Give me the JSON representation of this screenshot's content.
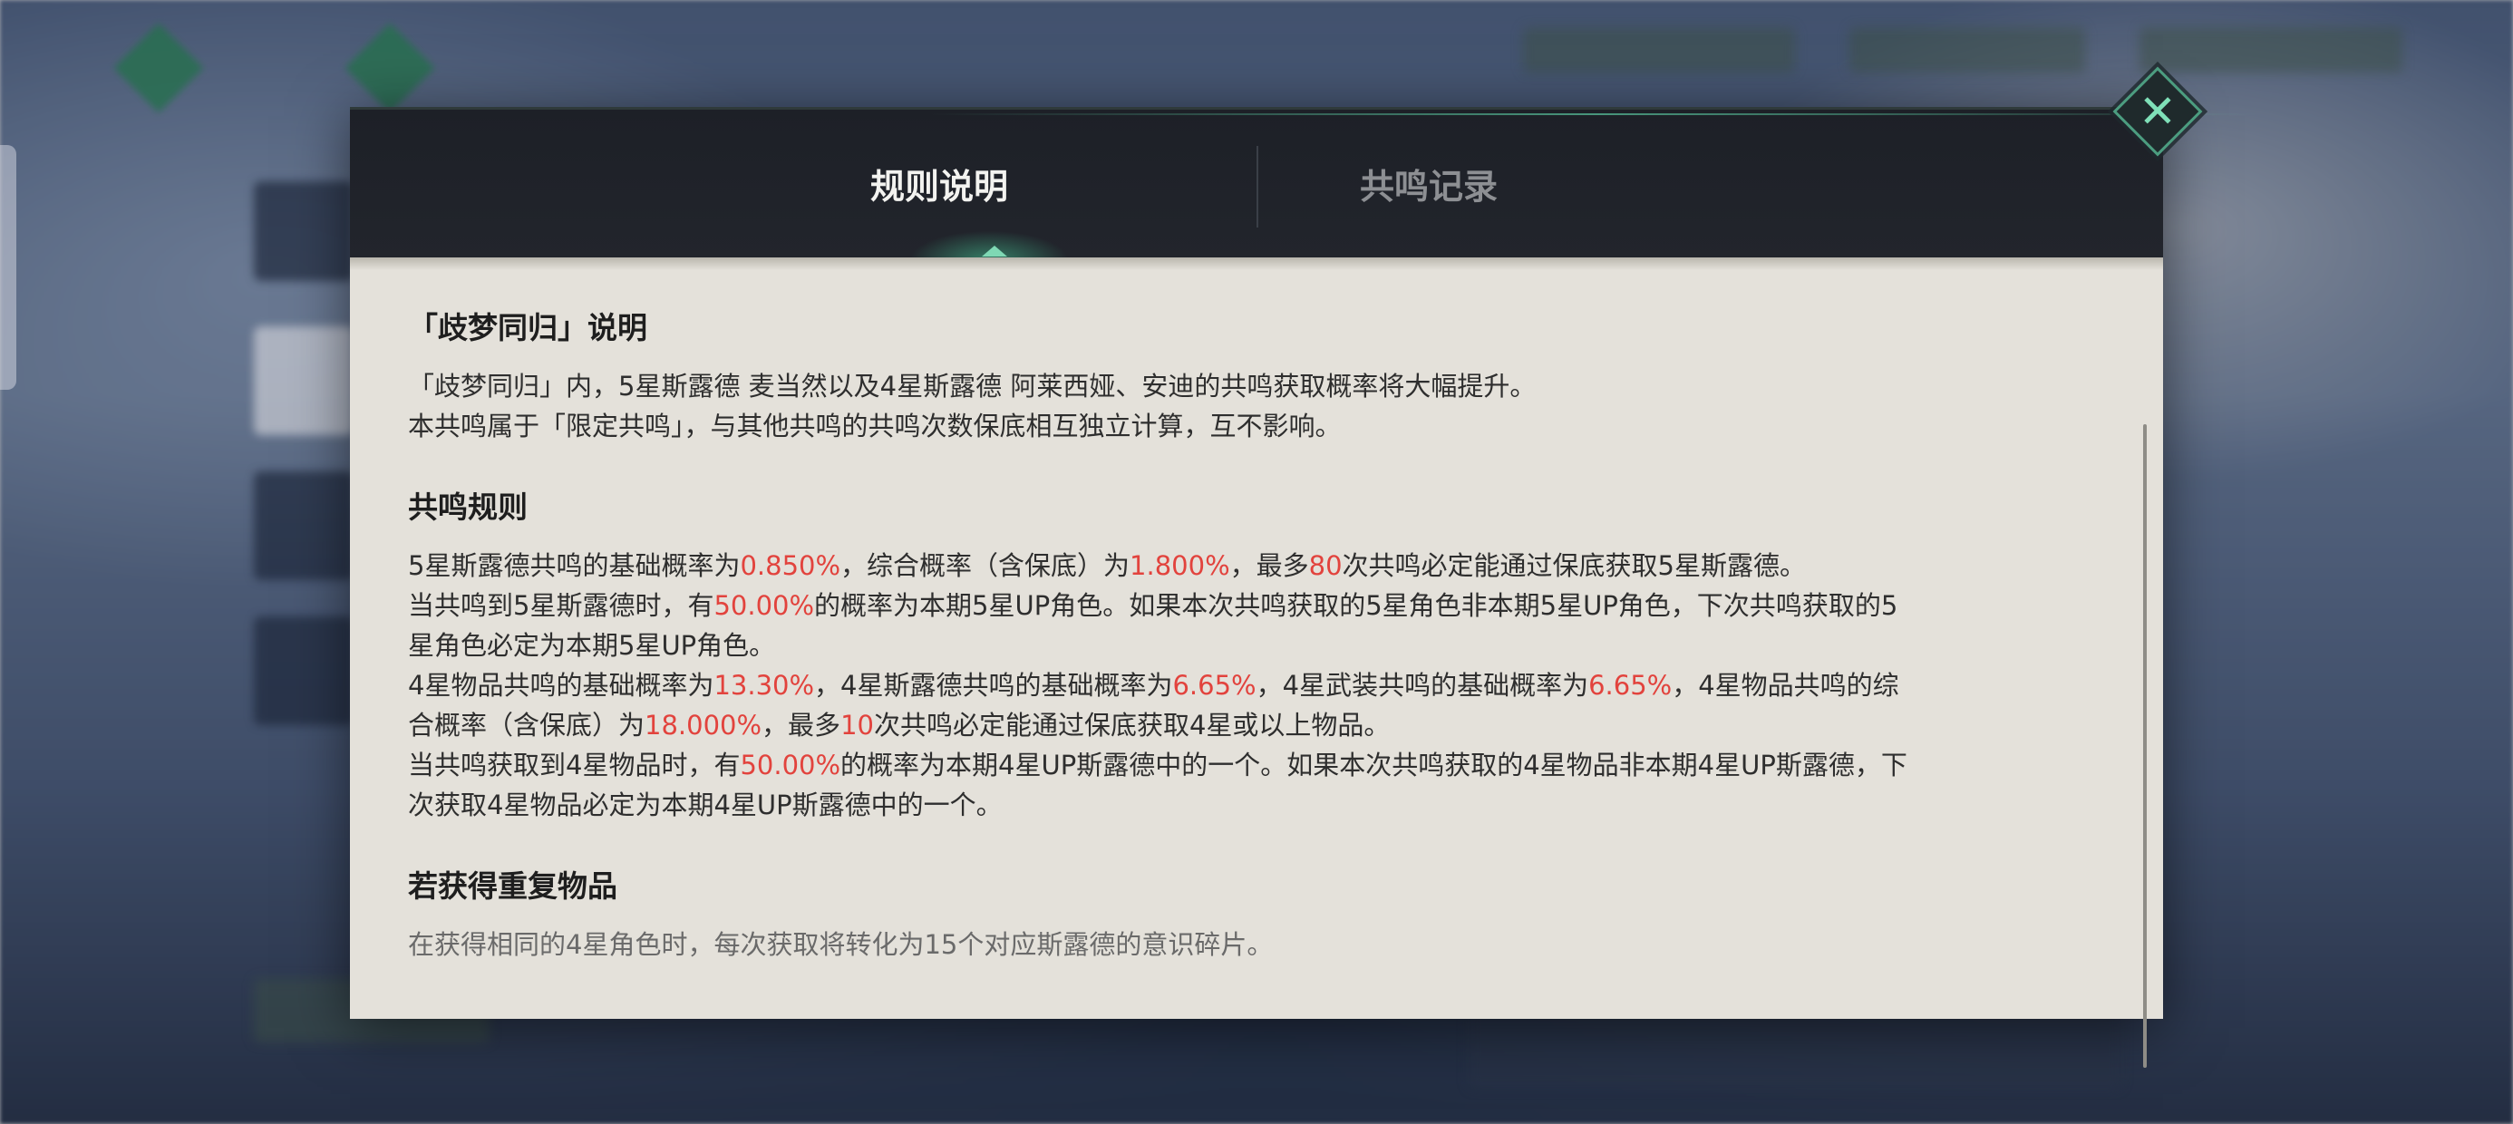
{
  "tabs": {
    "rules": "规则说明",
    "records": "共鸣记录"
  },
  "close_icon": "close-x-icon",
  "section1": {
    "title": "「歧梦同归」说明",
    "lines": [
      "「歧梦同归」内，5星斯露德 麦当然以及4星斯露德 阿莱西娅、安迪的共鸣获取概率将大幅提升。",
      "本共鸣属于「限定共鸣」，与其他共鸣的共鸣次数保底相互独立计算，互不影响。"
    ]
  },
  "section2": {
    "title": "共鸣规则",
    "p1": {
      "a": "5星斯露德共鸣的基础概率为",
      "v1": "0.850%",
      "b": "，综合概率（含保底）为",
      "v2": "1.800%",
      "c": "，最多",
      "v3": "80",
      "d": "次共鸣必定能通过保底获取5星斯露德。"
    },
    "p2": {
      "a": "当共鸣到5星斯露德时，有",
      "v1": "50.00%",
      "b": "的概率为本期5星UP角色。如果本次共鸣获取的5星角色非本期5星UP角色，下次共鸣获取的5",
      "c": "星角色必定为本期5星UP角色。"
    },
    "p3": {
      "a": "4星物品共鸣的基础概率为",
      "v1": "13.30%",
      "b": "，4星斯露德共鸣的基础概率为",
      "v2": "6.65%",
      "c": "，4星武装共鸣的基础概率为",
      "v3": "6.65%",
      "d": "，4星物品共鸣的综",
      "e": "合概率（含保底）为",
      "v4": "18.000%",
      "f": "，最多",
      "v5": "10",
      "g": "次共鸣必定能通过保底获取4星或以上物品。"
    },
    "p4": {
      "a": "当共鸣获取到4星物品时，有",
      "v1": "50.00%",
      "b": "的概率为本期4星UP斯露德中的一个。如果本次共鸣获取的4星物品非本期4星UP斯露德，下",
      "c": "次获取4星物品必定为本期4星UP斯露德中的一个。"
    }
  },
  "section3": {
    "title": "若获得重复物品",
    "line1": "在获得相同的4星角色时，每次获取将转化为15个对应斯露德的意识碎片。"
  },
  "colors": {
    "highlight": "#e2433d",
    "accent": "#7fd8b4",
    "header_bg": "#1d2027",
    "paper_bg": "#e4e1da"
  }
}
